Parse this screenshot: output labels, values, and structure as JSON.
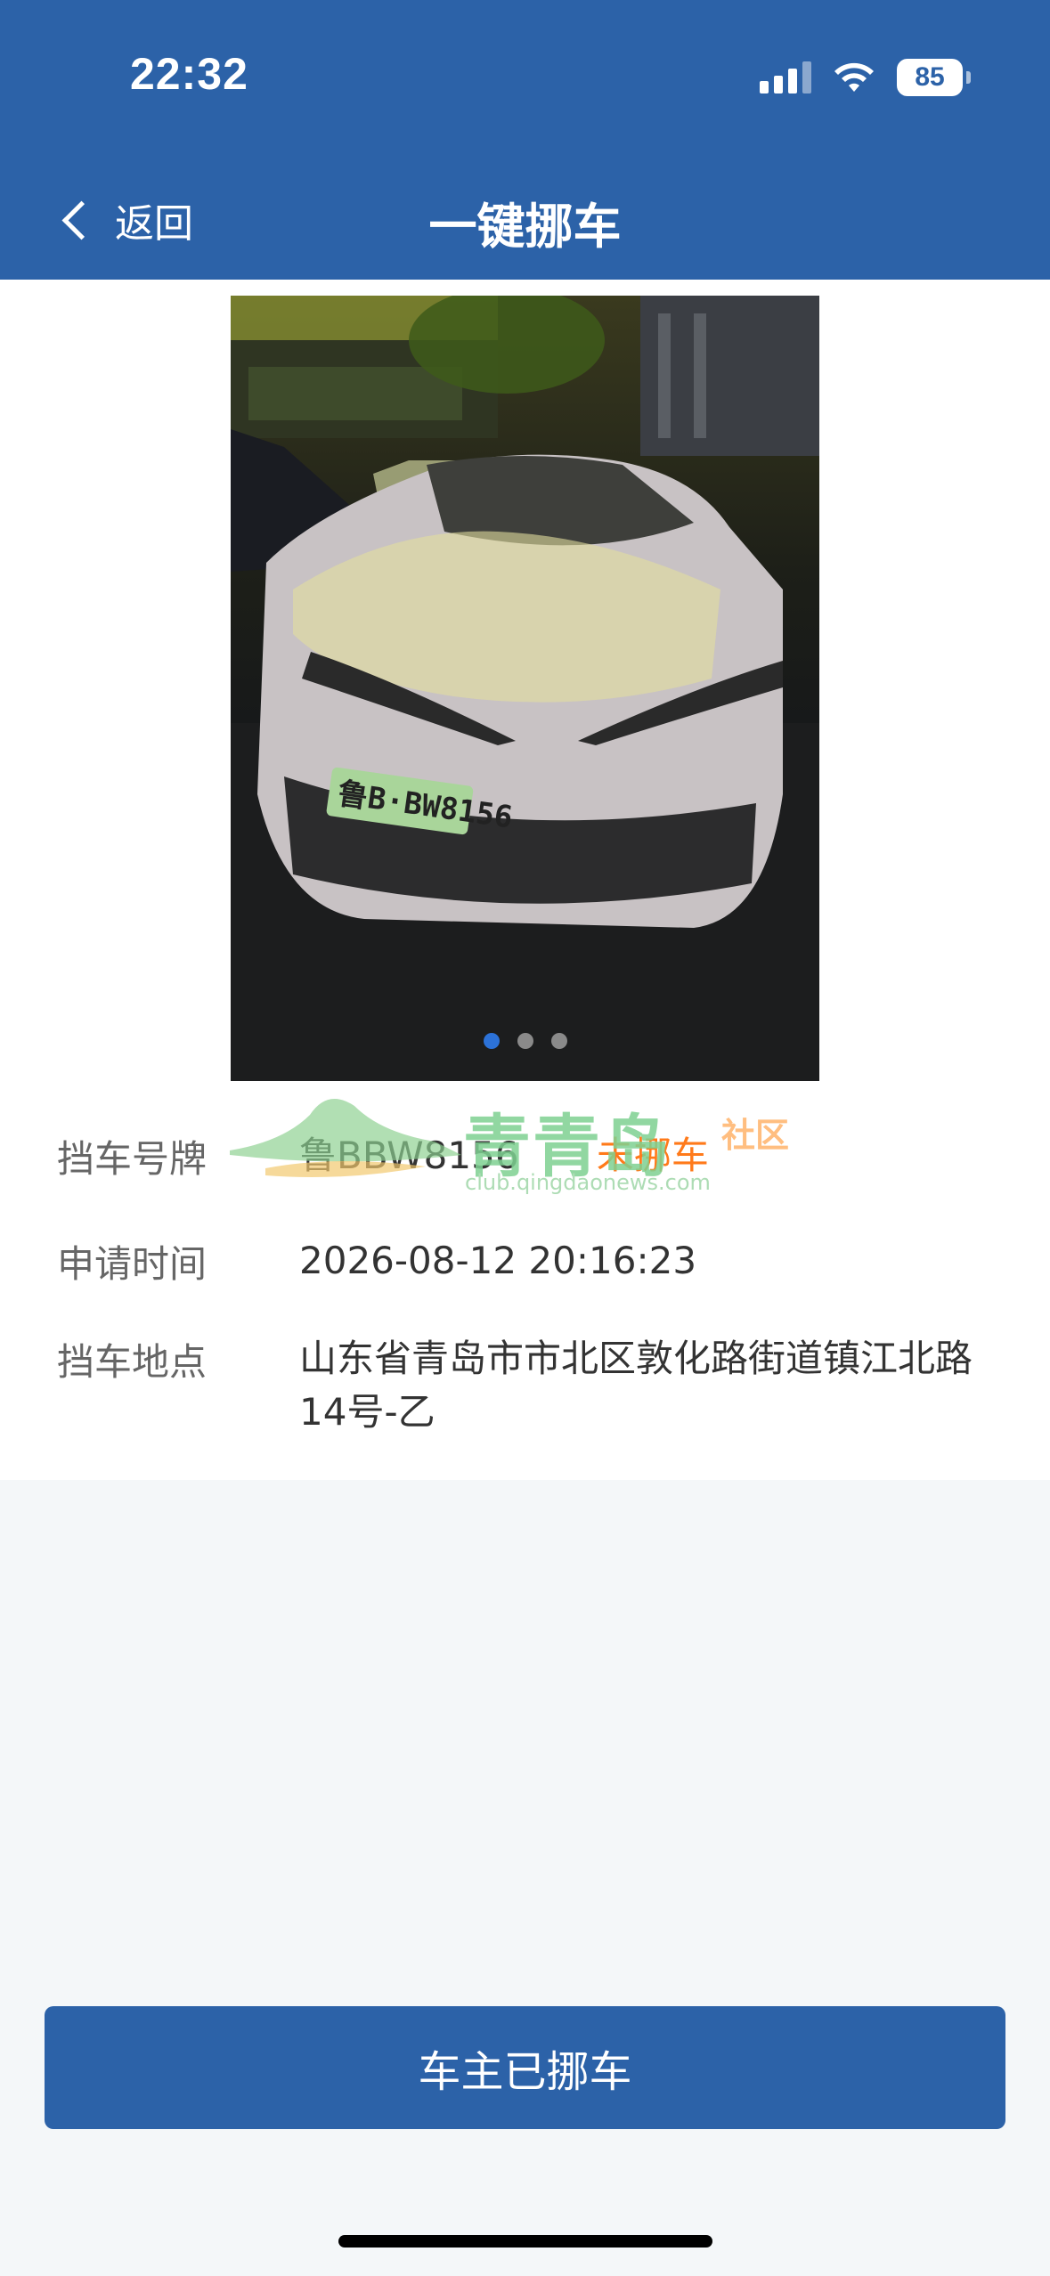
{
  "status_bar": {
    "time": "22:32",
    "battery": "85"
  },
  "nav": {
    "back_label": "返回",
    "title": "一键挪车"
  },
  "gallery": {
    "page_count": 3,
    "active_index": 0,
    "plate_text": "鲁B·BW8156"
  },
  "watermark": {
    "brand": "青青岛",
    "tag": "社区",
    "url": "club.qingdaonews.com"
  },
  "details": {
    "plate_label": "挡车号牌",
    "plate_value": "鲁BBW8156",
    "status": "未挪车",
    "time_label": "申请时间",
    "time_value": "2026-08-12 20:16:23",
    "location_label": "挡车地点",
    "location_value": "山东省青岛市市北区敦化路街道镇江北路14号-乙"
  },
  "action": {
    "confirm_label": "车主已挪车"
  },
  "colors": {
    "brand": "#2c62a8",
    "status_orange": "#ff7a1a",
    "page_bg": "#f4f7f9"
  }
}
